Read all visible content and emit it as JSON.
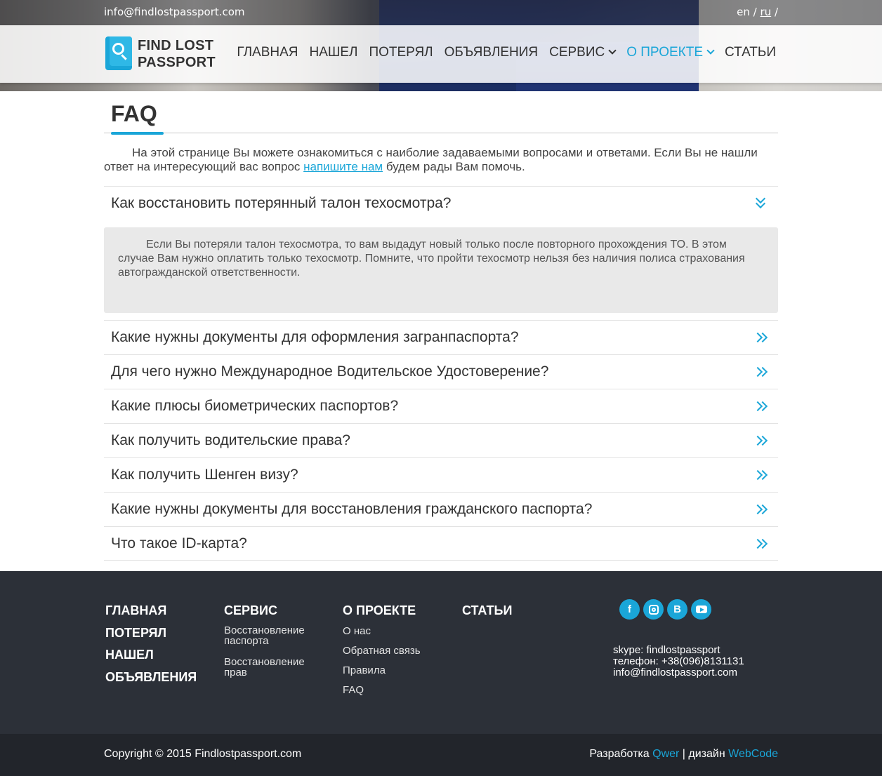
{
  "topbar": {
    "email": "info@findlostpassport.com",
    "lang_en": "en",
    "lang_sep": "/",
    "lang_ru": "ru",
    "lang_sep2": "/"
  },
  "logo": {
    "line1": "FIND LOST",
    "line2": "PASSPORT"
  },
  "nav": {
    "items": [
      {
        "label": "ГЛАВНАЯ"
      },
      {
        "label": "НАШЕЛ"
      },
      {
        "label": "ПОТЕРЯЛ"
      },
      {
        "label": "ОБЪЯВЛЕНИЯ"
      },
      {
        "label": "СЕРВИС"
      },
      {
        "label": "О ПРОЕКТЕ"
      },
      {
        "label": "СТАТЬИ"
      }
    ]
  },
  "page": {
    "title": "FAQ",
    "intro_before": "На этой странице Вы можете ознакомиться с наиболие задаваемыми вопросами и ответами. Если Вы не нашли ответ на интересующий вас вопрос ",
    "intro_link": "напишите нам",
    "intro_after": " будем рады Вам помочь."
  },
  "faq": {
    "open_question": "Как восстановить потерянный талон техосмотра?",
    "open_answer": "Если Вы потеряли талон техосмотра, то вам выдадут новый только после повторного прохождения ТО. В этом случае Вам нужно оплатить только техосмотр. Помните, что пройти техосмотр нельзя без наличия полиса страхования автогражданской ответственности.",
    "questions": [
      "Какие нужны документы для оформления загранпаспорта?",
      "Для чего нужно Международное Водительское Удостоверение?",
      "Какие плюсы биометрических паспортов?",
      "Как получить водительские права?",
      "Как получить Шенген визу?",
      "Какие нужны документы для восстановления гражданского паспорта?",
      "Что такое ID-карта?"
    ]
  },
  "footer": {
    "col1": [
      "ГЛАВНАЯ",
      "ПОТЕРЯЛ",
      "НАШЕЛ",
      "ОБЪЯВЛЕНИЯ"
    ],
    "col2": {
      "head": "СЕРВИС",
      "items": [
        "Восстановление паспорта",
        "Восстановление прав"
      ]
    },
    "col3": {
      "head": "О ПРОЕКТЕ",
      "items": [
        "О нас",
        "Обратная связь",
        "Правила",
        "FAQ"
      ]
    },
    "col4": {
      "head": "СТАТЬИ"
    },
    "social": {
      "vk": "В"
    },
    "contacts": {
      "skype": "skype: findlostpassport",
      "phone": "телефон: +38(096)8131131",
      "email": "info@findlostpassport.com"
    }
  },
  "bottom": {
    "copyright": "Copyright © 2015 Findlostpassport.com",
    "dev_label": "Разработка",
    "dev_name": "Qwer",
    "sep": " | ",
    "design_label": "дизайн",
    "design_name": "WebCode"
  },
  "colors": {
    "accent": "#1aa6d8",
    "footer_bg": "#2c3038",
    "bottom_bg": "#22252b",
    "answer_bg": "#e9e9e9"
  }
}
